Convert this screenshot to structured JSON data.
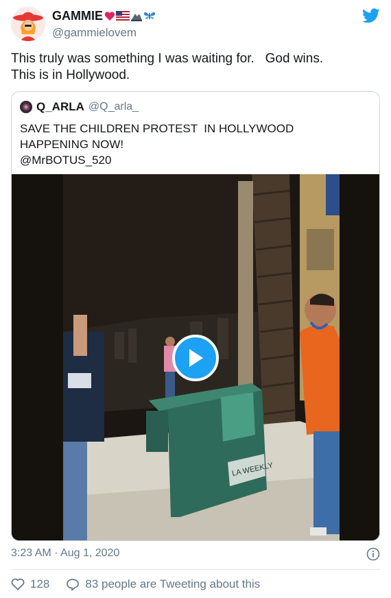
{
  "author": {
    "display_name": "GAMMIE",
    "handle": "@gammielovem"
  },
  "tweet": {
    "text": "This truly was something I was waiting for.   God wins.\nThis is in Hollywood.",
    "timestamp": "3:23 AM · Aug 1, 2020",
    "like_count": "128",
    "tweeting_about": "83 people are Tweeting about this"
  },
  "quoted_tweet": {
    "display_name": "Q_ARLA",
    "handle": "@Q_arla_",
    "text": "SAVE THE CHILDREN PROTEST  IN HOLLYWOOD\nHAPPENING NOW!\n@MrBOTUS_520"
  },
  "video": {
    "sign_text": "LA WEEKLY"
  },
  "icons": {
    "brand": "twitter-bird-icon",
    "play": "play-icon",
    "info": "info-icon",
    "like": "heart-icon",
    "reply": "speech-bubble-icon"
  },
  "colors": {
    "accent": "#1da1f2",
    "text": "#14171a",
    "secondary": "#657786",
    "border": "#ccd6dd"
  }
}
